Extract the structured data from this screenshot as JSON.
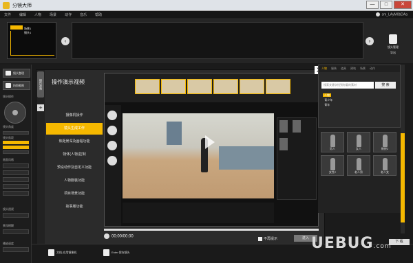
{
  "app": {
    "title": "分镜大师"
  },
  "window": {
    "minimize": "—",
    "maximize": "□",
    "close": "✕"
  },
  "menu": [
    "文件",
    "编辑",
    "人物",
    "场景",
    "动作",
    "音乐",
    "帮助"
  ],
  "user": {
    "name": "sm_LAyM0bDAa"
  },
  "storyboard": {
    "root": "",
    "branch1": "场景1",
    "branch2": "镜头1"
  },
  "shot_manager": {
    "label": "镜头管理",
    "sub": "导出"
  },
  "left_panel": {
    "btn1": "镜头整理",
    "btn2": "拍照截图",
    "camera_label": "镜头操作",
    "dial_label": "镜头角度",
    "lens_label": "镜头焦距",
    "style_label": "画面风格",
    "light_label": "镜头透视",
    "depth_label": "景深模糊",
    "speed_label": "播放速度"
  },
  "tutorial": {
    "side_tab": "操作视频",
    "title": "操作演示视频",
    "items": [
      "摄像机操作",
      "镜头生成工作",
      "焦距景深及画幅功能",
      "物体(人物)控制",
      "预设动作及自定义功能",
      "人物服装功能",
      "项目场景功能",
      "故事版功能"
    ],
    "active_index": 1,
    "time": "00:00/00:00",
    "dont_show": "不再提示",
    "enter": "进入",
    "close": "X",
    "progress": 0
  },
  "assets": {
    "tabs": [
      "人物",
      "服装",
      "道具",
      "建筑",
      "场景",
      "动作"
    ],
    "active_tab": "人物",
    "search_placeholder": "搜索关键字找到你要的素材",
    "search_button": "搜 索",
    "tree": [
      "人物",
      "青少年",
      "青年"
    ]
  },
  "characters": [
    "男人",
    "女人",
    "教授2",
    "女性2",
    "老人男",
    "老人女"
  ],
  "bottom": {
    "btn1": "文档-应用镜像机",
    "btn2": "Enter 保存镜头"
  },
  "watermark": "UEBUG",
  "watermark_suffix": ".com",
  "help": "下 载"
}
